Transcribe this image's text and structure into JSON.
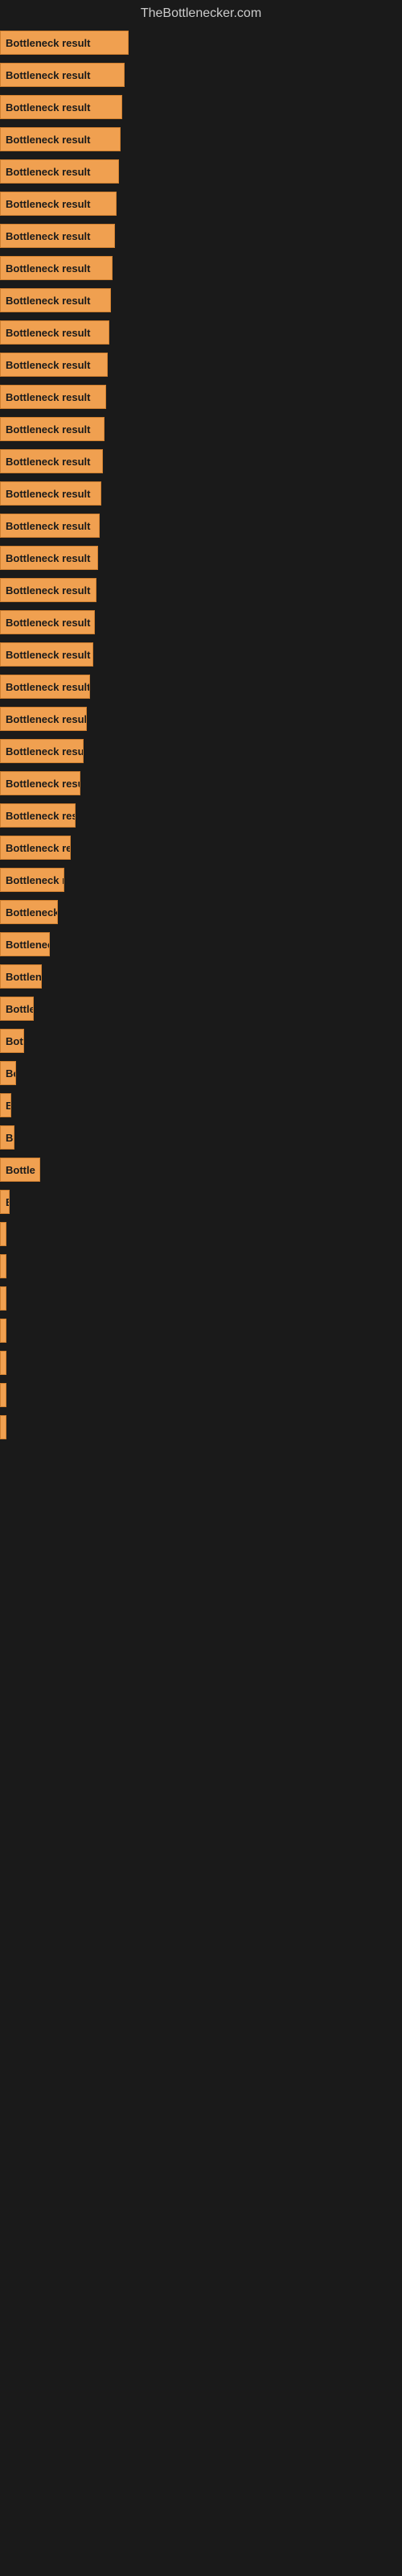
{
  "site": {
    "title": "TheBottlenecker.com"
  },
  "bars": [
    {
      "label": "Bottleneck result",
      "width": 160
    },
    {
      "label": "Bottleneck result",
      "width": 155
    },
    {
      "label": "Bottleneck result",
      "width": 152
    },
    {
      "label": "Bottleneck result",
      "width": 150
    },
    {
      "label": "Bottleneck result",
      "width": 148
    },
    {
      "label": "Bottleneck result",
      "width": 145
    },
    {
      "label": "Bottleneck result",
      "width": 143
    },
    {
      "label": "Bottleneck result",
      "width": 140
    },
    {
      "label": "Bottleneck result",
      "width": 138
    },
    {
      "label": "Bottleneck result",
      "width": 136
    },
    {
      "label": "Bottleneck result",
      "width": 134
    },
    {
      "label": "Bottleneck result",
      "width": 132
    },
    {
      "label": "Bottleneck result",
      "width": 130
    },
    {
      "label": "Bottleneck result",
      "width": 128
    },
    {
      "label": "Bottleneck result",
      "width": 126
    },
    {
      "label": "Bottleneck result",
      "width": 124
    },
    {
      "label": "Bottleneck result",
      "width": 122
    },
    {
      "label": "Bottleneck result",
      "width": 120
    },
    {
      "label": "Bottleneck result",
      "width": 118
    },
    {
      "label": "Bottleneck result",
      "width": 116
    },
    {
      "label": "Bottleneck result",
      "width": 112
    },
    {
      "label": "Bottleneck result",
      "width": 108
    },
    {
      "label": "Bottleneck result",
      "width": 104
    },
    {
      "label": "Bottleneck result",
      "width": 100
    },
    {
      "label": "Bottleneck result",
      "width": 94
    },
    {
      "label": "Bottleneck result",
      "width": 88
    },
    {
      "label": "Bottleneck result",
      "width": 80
    },
    {
      "label": "Bottleneck result",
      "width": 72
    },
    {
      "label": "Bottleneck result",
      "width": 62
    },
    {
      "label": "Bottleneck result",
      "width": 52
    },
    {
      "label": "Bottleneck result",
      "width": 42
    },
    {
      "label": "Bottleneck result",
      "width": 30
    },
    {
      "label": "Bottleneck result",
      "width": 20
    },
    {
      "label": "B",
      "width": 14
    },
    {
      "label": "Bo",
      "width": 18
    },
    {
      "label": "Bottle",
      "width": 50
    },
    {
      "label": "B",
      "width": 12
    },
    {
      "label": "",
      "width": 4
    },
    {
      "label": "",
      "width": 4
    },
    {
      "label": "",
      "width": 4
    },
    {
      "label": "",
      "width": 4
    },
    {
      "label": "",
      "width": 4
    },
    {
      "label": "",
      "width": 4
    },
    {
      "label": "",
      "width": 2
    }
  ]
}
